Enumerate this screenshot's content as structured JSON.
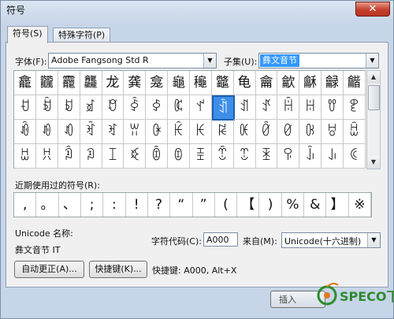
{
  "window": {
    "title": "符号",
    "close_glyph": "✕"
  },
  "tabs": [
    {
      "label": "符号(S)"
    },
    {
      "label": "特殊字符(P)"
    }
  ],
  "font": {
    "label": "字体(F):",
    "value": "Adobe Fangsong Std R"
  },
  "subset": {
    "label": "子集(U):",
    "value": "彝文音节"
  },
  "symbol_grid": {
    "rows": [
      [
        "龕",
        "龖",
        "龗",
        "龘",
        "龙",
        "龚",
        "龛",
        "龜",
        "龝",
        "龞",
        "龟",
        "龠",
        "龡",
        "龢",
        "龣",
        "龤"
      ],
      [
        "ꀀ",
        "ꀁ",
        "ꀂ",
        "ꀃ",
        "ꀄ",
        "ꀅ",
        "ꀆ",
        "ꀇ",
        "ꀈ",
        "ꀉ",
        "ꀊ",
        "ꀋ",
        "ꀌ",
        "ꀍ",
        "ꀎ",
        "ꀏ"
      ],
      [
        "ꀐ",
        "ꀑ",
        "ꀒ",
        "ꀓ",
        "ꀔ",
        "ꀕ",
        "ꀖ",
        "ꀗ",
        "ꀘ",
        "ꀙ",
        "ꀚ",
        "ꀛ",
        "ꀜ",
        "ꀝ",
        "ꀞ",
        "ꀟ"
      ],
      [
        "ꀠ",
        "ꀡ",
        "ꀢ",
        "ꀣ",
        "ꀤ",
        "ꀥ",
        "ꀦ",
        "ꀧ",
        "ꀨ",
        "ꀩ",
        "ꀪ",
        "ꀫ",
        "ꀬ",
        "ꀭ",
        "ꀮ",
        "ꀯ"
      ]
    ],
    "selected": {
      "row": 1,
      "col": 9
    }
  },
  "recent": {
    "label": "近期使用过的符号(R):",
    "symbols": [
      ",",
      "。",
      "、",
      ";",
      ":",
      "!",
      "?",
      "“",
      "”",
      "(",
      "【",
      ")",
      "%",
      "&",
      "】",
      "※"
    ]
  },
  "unicode_name": {
    "label": "Unicode 名称:",
    "value": "彝文音节 IT"
  },
  "char_code": {
    "label": "字符代码(C):",
    "value": "A000"
  },
  "from": {
    "label": "来自(M):",
    "value": "Unicode(十六进制)"
  },
  "buttons": {
    "autocorrect": "自动更正(A)...",
    "shortcut_key": "快捷键(K)...",
    "insert": "插入"
  },
  "shortcut_text": "快捷键: A000, Alt+X",
  "watermark": {
    "text": "SPECO下载"
  }
}
